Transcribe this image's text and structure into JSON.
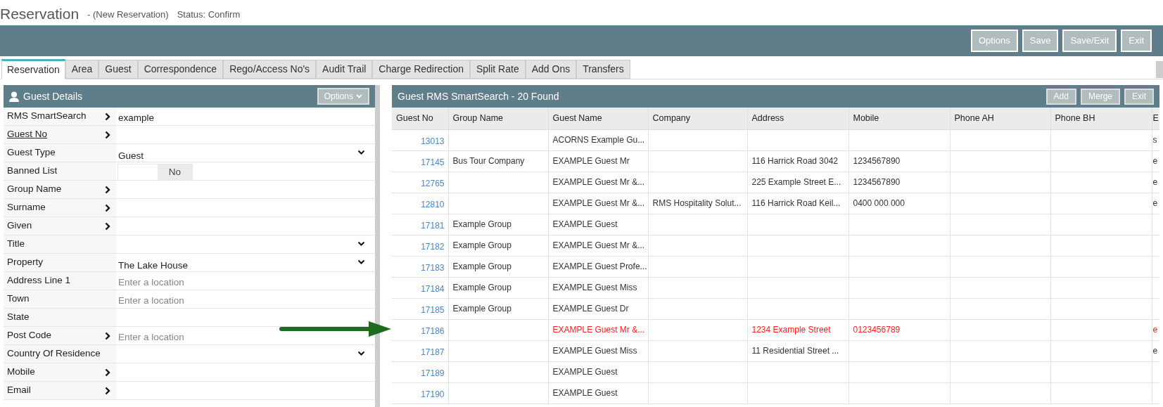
{
  "header": {
    "title": "Reservation",
    "subtitle": "- (New Reservation)",
    "status": "Status: Confirm"
  },
  "toolbar_buttons": [
    "Options",
    "Save",
    "Save/Exit",
    "Exit"
  ],
  "tabs": [
    {
      "label": "Reservation",
      "selected": true
    },
    {
      "label": "Area",
      "selected": false
    },
    {
      "label": "Guest",
      "selected": false
    },
    {
      "label": "Correspondence",
      "selected": false
    },
    {
      "label": "Rego/Access No's",
      "selected": false
    },
    {
      "label": "Audit Trail",
      "selected": false
    },
    {
      "label": "Charge Redirection",
      "selected": false
    },
    {
      "label": "Split Rate",
      "selected": false
    },
    {
      "label": "Add Ons",
      "selected": false
    },
    {
      "label": "Transfers",
      "selected": false
    }
  ],
  "guest_details": {
    "title": "Guest Details",
    "options_button": "Options",
    "fields": [
      {
        "label": "RMS SmartSearch",
        "link": false,
        "arrow": true,
        "kind": "text",
        "value": "example"
      },
      {
        "label": "Guest No",
        "link": true,
        "arrow": true,
        "kind": "text"
      },
      {
        "label": "Guest Type",
        "link": false,
        "arrow": false,
        "kind": "select",
        "value": "Guest"
      },
      {
        "label": "Banned List",
        "link": false,
        "arrow": false,
        "kind": "toggle",
        "value": "No",
        "on": false
      },
      {
        "label": "Group Name",
        "link": false,
        "arrow": true,
        "kind": "text"
      },
      {
        "label": "Surname",
        "link": false,
        "arrow": true,
        "kind": "text"
      },
      {
        "label": "Given",
        "link": false,
        "arrow": true,
        "kind": "text"
      },
      {
        "label": "Title",
        "link": false,
        "arrow": false,
        "kind": "select"
      },
      {
        "label": "Property",
        "link": false,
        "arrow": false,
        "kind": "select",
        "value": "The Lake House"
      },
      {
        "label": "Address Line 1",
        "link": false,
        "arrow": false,
        "kind": "text",
        "placeholder": "Enter a location"
      },
      {
        "label": "Town",
        "link": false,
        "arrow": false,
        "kind": "text",
        "placeholder": "Enter a location"
      },
      {
        "label": "State",
        "link": false,
        "arrow": false,
        "kind": "text"
      },
      {
        "label": "Post Code",
        "link": false,
        "arrow": true,
        "kind": "text",
        "placeholder": "Enter a location"
      },
      {
        "label": "Country Of Residence",
        "link": false,
        "arrow": false,
        "kind": "select"
      },
      {
        "label": "Mobile",
        "link": false,
        "arrow": true,
        "kind": "text"
      },
      {
        "label": "Email",
        "link": false,
        "arrow": true,
        "kind": "text"
      }
    ]
  },
  "search_results": {
    "title": "Guest RMS SmartSearch - 20 Found",
    "buttons": [
      "Add",
      "Merge",
      "Exit"
    ],
    "columns": [
      "Guest No",
      "Group Name",
      "Guest Name",
      "Company",
      "Address",
      "Mobile",
      "Phone AH",
      "Phone BH",
      "E"
    ],
    "rows": [
      {
        "highlighted": false,
        "cells": [
          "13013",
          "",
          "ACORNS Example Gu...",
          "",
          "",
          "",
          "",
          "",
          "s"
        ]
      },
      {
        "highlighted": false,
        "cells": [
          "17145",
          "Bus Tour Company",
          "EXAMPLE Guest Mr",
          "",
          "116 Harrick Road 3042",
          "1234567890",
          "",
          "",
          "e"
        ]
      },
      {
        "highlighted": false,
        "cells": [
          "12765",
          "",
          "EXAMPLE Guest Mr &...",
          "",
          "225 Example Street E...",
          "1234567890",
          "",
          "",
          "e"
        ]
      },
      {
        "highlighted": false,
        "cells": [
          "12810",
          "",
          "EXAMPLE Guest Mr &...",
          "RMS Hospitality Solut...",
          "116 Harrick Road Keil...",
          "0400 000 000",
          "",
          "",
          "e"
        ]
      },
      {
        "highlighted": false,
        "cells": [
          "17181",
          "Example Group",
          "EXAMPLE Guest",
          "",
          "",
          "",
          "",
          "",
          ""
        ]
      },
      {
        "highlighted": false,
        "cells": [
          "17182",
          "Example Group",
          "EXAMPLE Guest Mr &...",
          "",
          "",
          "",
          "",
          "",
          ""
        ]
      },
      {
        "highlighted": false,
        "cells": [
          "17183",
          "Example Group",
          "EXAMPLE Guest Profe...",
          "",
          "",
          "",
          "",
          "",
          ""
        ]
      },
      {
        "highlighted": false,
        "cells": [
          "17184",
          "Example Group",
          "EXAMPLE Guest Miss",
          "",
          "",
          "",
          "",
          "",
          ""
        ]
      },
      {
        "highlighted": false,
        "cells": [
          "17185",
          "Example Group",
          "EXAMPLE Guest Dr",
          "",
          "",
          "",
          "",
          "",
          ""
        ]
      },
      {
        "highlighted": true,
        "pointed": true,
        "cells": [
          "17186",
          "",
          "EXAMPLE Guest Mr &...",
          "",
          "1234 Example Street",
          "0123456789",
          "",
          "",
          "e"
        ]
      },
      {
        "highlighted": false,
        "cells": [
          "17187",
          "",
          "EXAMPLE Guest Miss",
          "",
          "11 Residential Street ...",
          "",
          "",
          "",
          "e"
        ]
      },
      {
        "highlighted": false,
        "cells": [
          "17189",
          "",
          "EXAMPLE Guest",
          "",
          "",
          "",
          "",
          "",
          ""
        ]
      },
      {
        "highlighted": false,
        "cells": [
          "17190",
          "",
          "EXAMPLE Guest",
          "",
          "",
          "",
          "",
          "",
          ""
        ]
      }
    ]
  }
}
